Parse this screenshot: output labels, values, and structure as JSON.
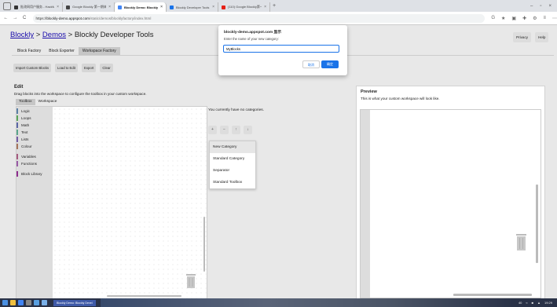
{
  "browser": {
    "tabs": [
      {
        "title": "批改网用户服务 - HackMD",
        "fav": "#333333"
      },
      {
        "title": "Google Blockly 第一期体验 ×",
        "fav": "#444444"
      },
      {
        "title": "Blockly Demo: Blockly Develo",
        "fav": "#4285f4",
        "active": true
      },
      {
        "title": "Blockly Developer Tools",
        "fav": "#1a73e8"
      },
      {
        "title": "(110) Google Blockly第一期体验",
        "fav": "#e62117"
      }
    ],
    "tab_close": "×",
    "new_tab": "+",
    "window_buttons": [
      "–",
      "▫",
      "×"
    ],
    "nav": {
      "back": "←",
      "forward": "→",
      "reload": "C"
    },
    "url_scheme": "https://",
    "url_host": "blockly-demo.appspot.com",
    "url_path": "/static/demos/blocklyfactory/index.html",
    "toolbar_icons": [
      "G",
      "★",
      "▣",
      "✚",
      "⚙",
      "≡",
      "⋯"
    ]
  },
  "page": {
    "breadcrumb_1": "Blockly",
    "sep_1": " > ",
    "breadcrumb_2": "Demos",
    "sep_2": " > ",
    "title_tail": "Blockly Developer Tools",
    "privacy": "Privacy",
    "help": "Help",
    "tabs": [
      "Block Factory",
      "Block Exporter",
      "Workspace Factory"
    ],
    "toolbar": [
      "Import Custom Blocks",
      "Load to Edit",
      "Export",
      "Clear"
    ],
    "edit_heading": "Edit",
    "edit_desc": "Drag blocks into the workspace to configure the toolbox in your custom workspace.",
    "ws_tabs": [
      "Toolbox",
      "Workspace"
    ],
    "categories": [
      {
        "label": "Logic",
        "color": "#5b80a5"
      },
      {
        "label": "Loops",
        "color": "#5ba55b"
      },
      {
        "label": "Math",
        "color": "#5b67a5"
      },
      {
        "label": "Text",
        "color": "#5ba58c"
      },
      {
        "label": "Lists",
        "color": "#745ba5"
      },
      {
        "label": "Colour",
        "color": "#a5745b"
      },
      {
        "label": "Variables",
        "color": "#a55b80"
      },
      {
        "label": "Functions",
        "color": "#995ba5"
      },
      {
        "label": "Block Library",
        "color": "#8e2d8e"
      }
    ],
    "no_categories": "You currently have no categories.",
    "controls": [
      "+",
      "−",
      "↑",
      "↓"
    ],
    "menu": [
      "New Category",
      "Standard Category",
      "Separator",
      "Standard Toolbox"
    ],
    "preview_heading": "Preview",
    "preview_desc": "This is what your custom workspace will look like."
  },
  "dialog": {
    "title": "blockly-demo.appspot.com 显示",
    "message": "Enter the name of your new category:",
    "value": "MyBlocks",
    "cancel": "取消",
    "ok": "确定"
  },
  "taskbar": {
    "app_label": "Blockly Demo: Blockly Devel",
    "tray": [
      "40",
      "≈",
      "■",
      "▲",
      "19:29"
    ]
  }
}
